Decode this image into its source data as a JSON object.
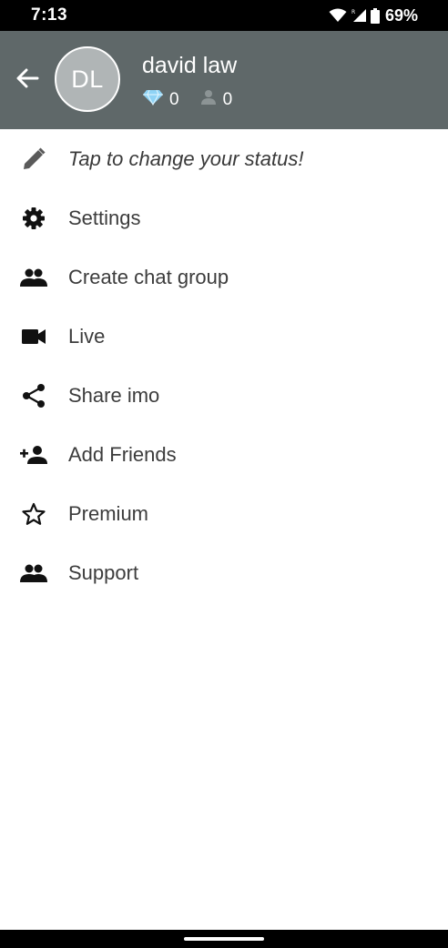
{
  "status_bar": {
    "time": "7:13",
    "battery": "69%",
    "icons": [
      "wifi-icon",
      "cell-signal-icon",
      "battery-icon"
    ]
  },
  "header": {
    "back_icon": "arrow-left-icon",
    "avatar_initials": "DL",
    "user_name": "david law",
    "diamonds_count": "0",
    "followers_count": "0",
    "background_color": "#5f6869"
  },
  "menu": {
    "items": [
      {
        "label": "Tap to change your status!",
        "icon": "pencil-icon"
      },
      {
        "label": "Settings",
        "icon": "gear-icon"
      },
      {
        "label": "Create chat group",
        "icon": "group-icon"
      },
      {
        "label": "Live",
        "icon": "video-camera-icon"
      },
      {
        "label": "Share imo",
        "icon": "share-icon"
      },
      {
        "label": "Add Friends",
        "icon": "add-person-icon"
      },
      {
        "label": "Premium",
        "icon": "star-outline-icon"
      },
      {
        "label": "Support",
        "icon": "group-icon"
      }
    ]
  }
}
